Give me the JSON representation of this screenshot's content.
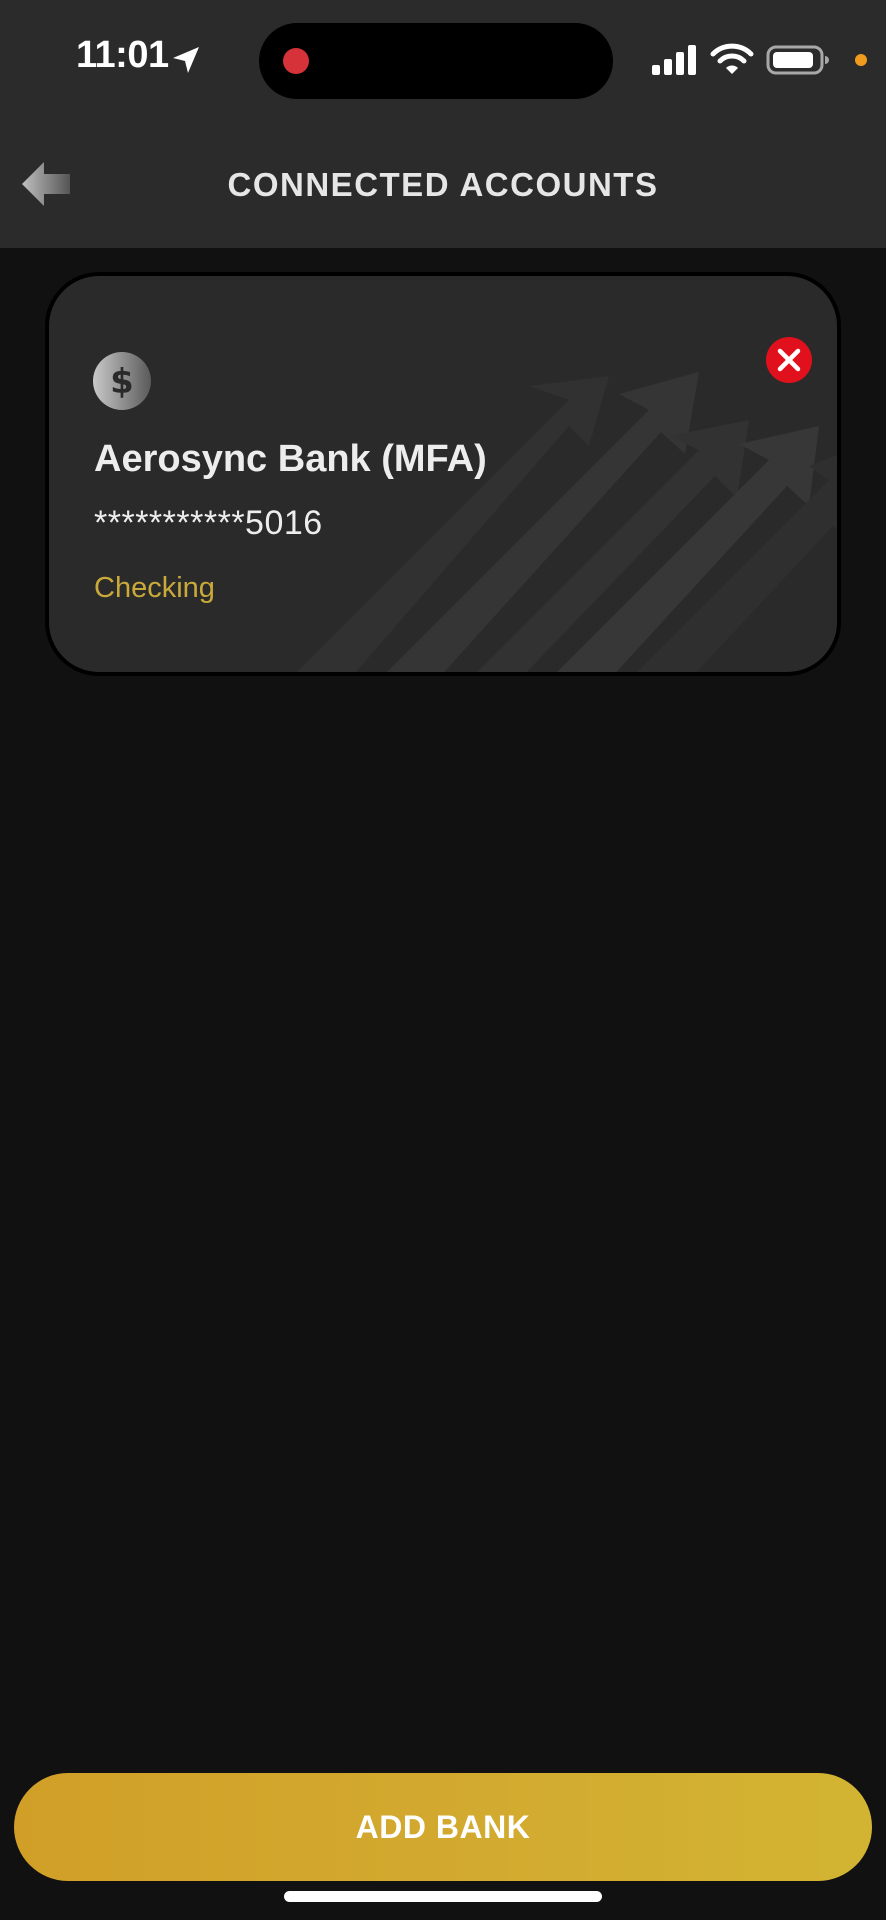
{
  "status_bar": {
    "time": "11:01",
    "icons": [
      "location-arrow-icon",
      "cellular-signal-icon",
      "wifi-icon",
      "battery-icon"
    ],
    "recording_indicator_color": "#d6323a",
    "privacy_indicator_color": "#f29a1e"
  },
  "header": {
    "title": "CONNECTED ACCOUNTS",
    "back_icon": "back-arrow-icon"
  },
  "accounts": [
    {
      "icon": "dollar-coin-icon",
      "name": "Aerosync Bank (MFA)",
      "masked_number": "***********5016",
      "type": "Checking",
      "remove_icon": "close-circle-icon"
    }
  ],
  "footer": {
    "add_bank_label": "ADD BANK"
  },
  "colors": {
    "background": "#111111",
    "header_background": "#2b2b2b",
    "card_background": "#2a2a2a",
    "accent_gold": "#d2aa2f",
    "account_type_text": "#c9a93a",
    "remove_red": "#e0101c"
  }
}
